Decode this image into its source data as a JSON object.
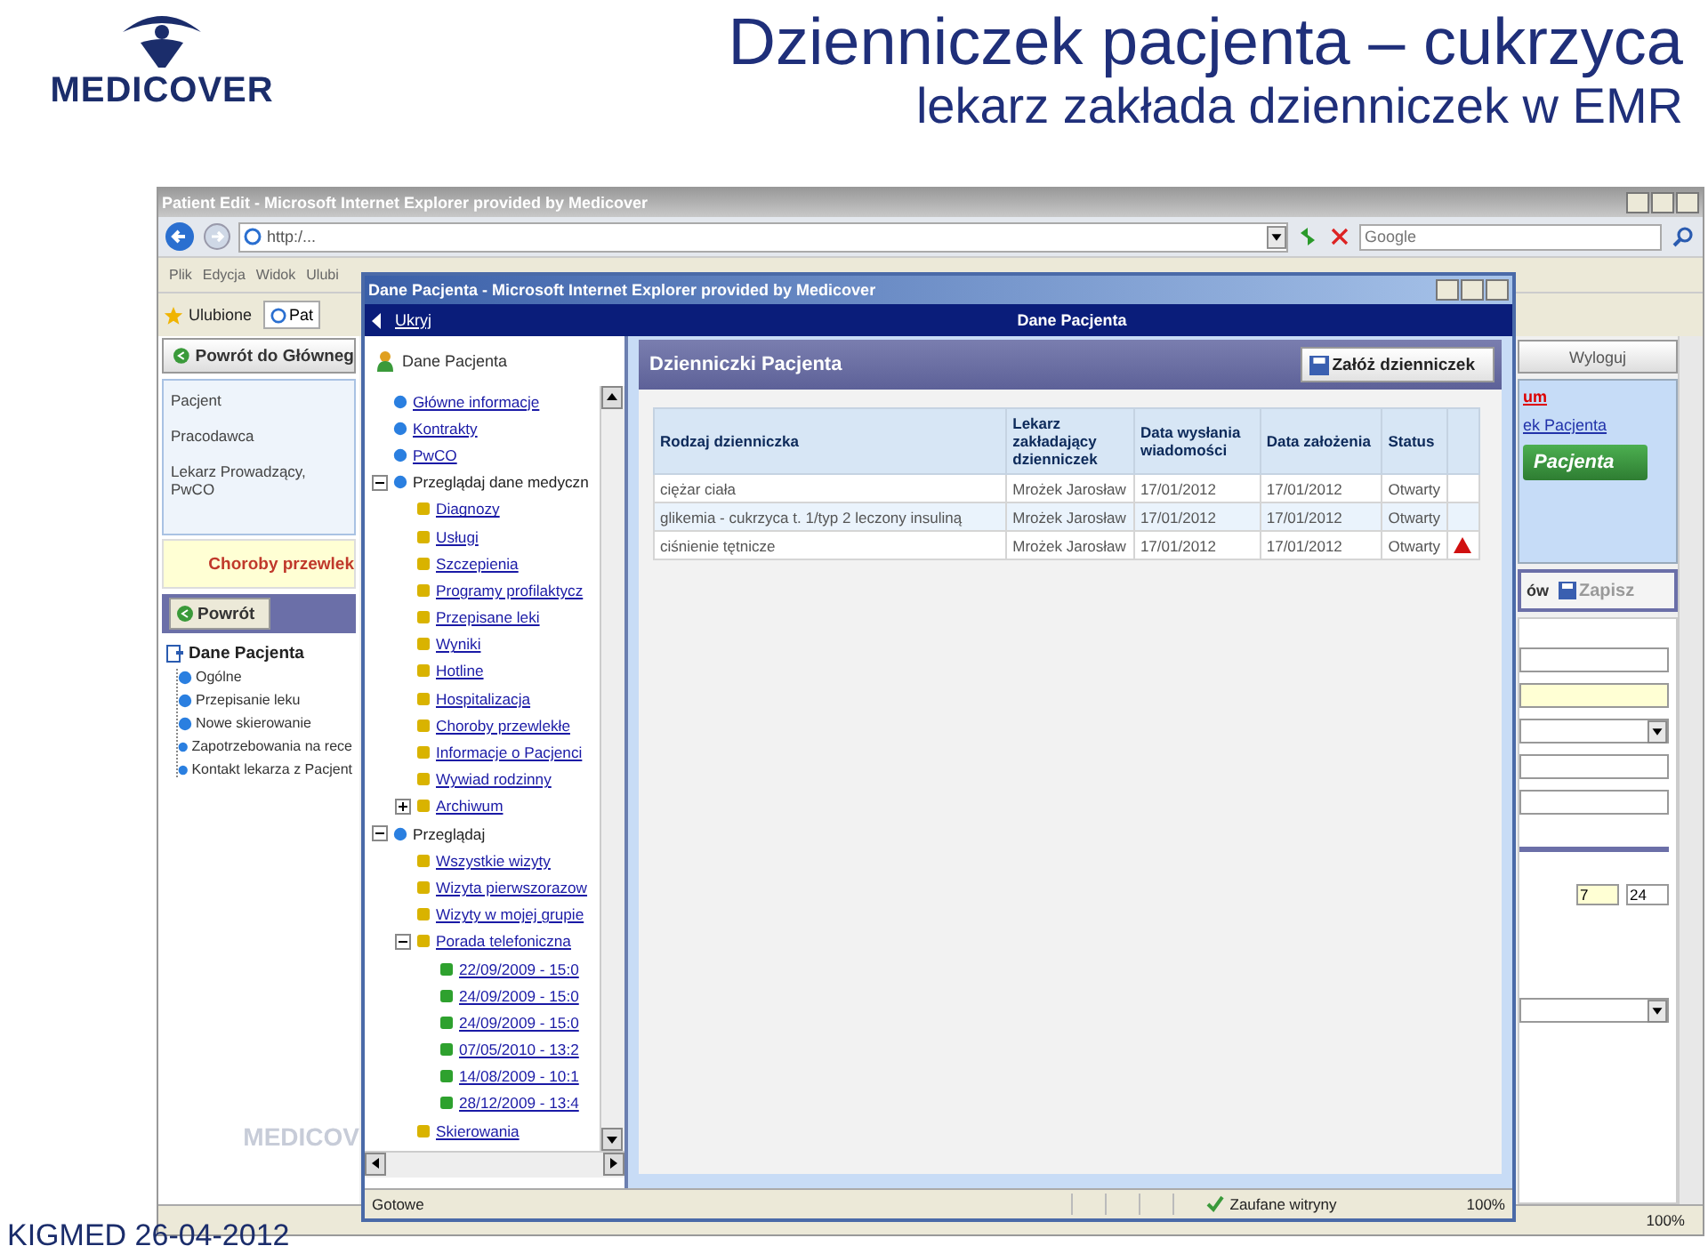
{
  "slide": {
    "logo": "MEDICOVER",
    "title": "Dzienniczek pacjenta – cukrzyca",
    "subtitle": "lekarz zakłada dzienniczek w EMR",
    "footer": "KIGMED 26-04-2012"
  },
  "back_window": {
    "title": "Patient Edit - Microsoft Internet Explorer provided by Medicover",
    "address": "http:/...",
    "search_placeholder": "Google",
    "menu": [
      "Plik",
      "Edycja",
      "Widok",
      "Ulubi"
    ],
    "favorites": "Ulubione",
    "tab": "Pat",
    "home_button": "Powrót do Główneg",
    "logout_button": "Wyloguj",
    "fields": [
      "Pacjent",
      "Pracodawca",
      "Lekarz Prowadzący, PwCO"
    ],
    "alert": "Choroby przewlek",
    "return_button": "Powrót",
    "tree": {
      "label": "Dane Pacjenta",
      "children": [
        "Ogólne",
        "Przepisanie leku",
        "Nowe skierowanie",
        "Zapotrzebowania na rece",
        "Kontakt lekarza z Pacjent"
      ]
    },
    "page_logo": "MEDICOV",
    "alert_link": "um",
    "patient_link": "ek Pacjenta",
    "green_button": "Pacjenta",
    "toolbar_item": "ów",
    "save_button": "Zapisz",
    "inputs": [
      {
        "value": "7",
        "highlighted": true
      },
      {
        "value": "24",
        "highlighted": false
      }
    ],
    "zoom": "100%"
  },
  "inner_window": {
    "title": "Dane Pacjenta - Microsoft Internet Explorer provided by Medicover",
    "hide_link": "Ukryj",
    "header": "Dane Pacjenta",
    "sidebar": {
      "title": "Dane Pacjenta",
      "tree": [
        {
          "label": "Główne informacje",
          "link": true
        },
        {
          "label": "Kontrakty",
          "link": true
        },
        {
          "label": "PwCO",
          "link": true
        },
        {
          "label": "Przeglądaj dane medyczn",
          "link": false,
          "expanded": true,
          "children": [
            {
              "label": "Diagnozy",
              "link": true
            },
            {
              "label": "Usługi",
              "link": true
            },
            {
              "label": "Szczepienia",
              "link": true
            },
            {
              "label": "Programy profilaktycz",
              "link": true
            },
            {
              "label": "Przepisane leki",
              "link": true
            },
            {
              "label": "Wyniki",
              "link": true
            },
            {
              "label": "Hotline",
              "link": true
            },
            {
              "label": "Hospitalizacja",
              "link": true
            },
            {
              "label": "Choroby przewlekłe",
              "link": true
            },
            {
              "label": "Informacje o Pacjenci",
              "link": true
            },
            {
              "label": "Wywiad rodzinny",
              "link": true
            },
            {
              "label": "Archiwum",
              "link": true,
              "expanded": false
            }
          ]
        },
        {
          "label": "Przeglądaj",
          "link": false,
          "expanded": true,
          "children": [
            {
              "label": "Wszystkie wizyty",
              "link": true
            },
            {
              "label": "Wizyta pierwszorazow",
              "link": true
            },
            {
              "label": "Wizyty w mojej grupie",
              "link": true
            },
            {
              "label": "Porada telefoniczna",
              "link": true,
              "expanded": true,
              "children": [
                {
                  "label": "22/09/2009 - 15:0",
                  "link": true
                },
                {
                  "label": "24/09/2009 - 15:0",
                  "link": true
                },
                {
                  "label": "24/09/2009 - 15:0",
                  "link": true
                },
                {
                  "label": "07/05/2010 - 13:2",
                  "link": true
                },
                {
                  "label": "14/08/2009 - 10:1",
                  "link": true
                },
                {
                  "label": "28/12/2009 - 13:4",
                  "link": true
                }
              ]
            },
            {
              "label": "Skierowania",
              "link": true
            }
          ]
        }
      ]
    },
    "panel_title": "Dzienniczki Pacjenta",
    "create_button": "Załóż dzienniczek",
    "table": {
      "columns": [
        "Rodzaj dzienniczka",
        "Lekarz zakładający dzienniczek",
        "Data wysłania wiadomości",
        "Data założenia",
        "Status"
      ],
      "rows": [
        {
          "cells": [
            "ciężar ciała",
            "Mrożek Jarosław",
            "17/01/2012",
            "17/01/2012",
            "Otwarty"
          ],
          "alert": false
        },
        {
          "cells": [
            "glikemia - cukrzyca t. 1/typ 2 leczony insuliną",
            "Mrożek Jarosław",
            "17/01/2012",
            "17/01/2012",
            "Otwarty"
          ],
          "alert": false
        },
        {
          "cells": [
            "ciśnienie tętnicze",
            "Mrożek Jarosław",
            "17/01/2012",
            "17/01/2012",
            "Otwarty"
          ],
          "alert": true
        }
      ]
    },
    "status": "Gotowe",
    "zone": "Zaufane witryny",
    "zoom": "100%"
  }
}
